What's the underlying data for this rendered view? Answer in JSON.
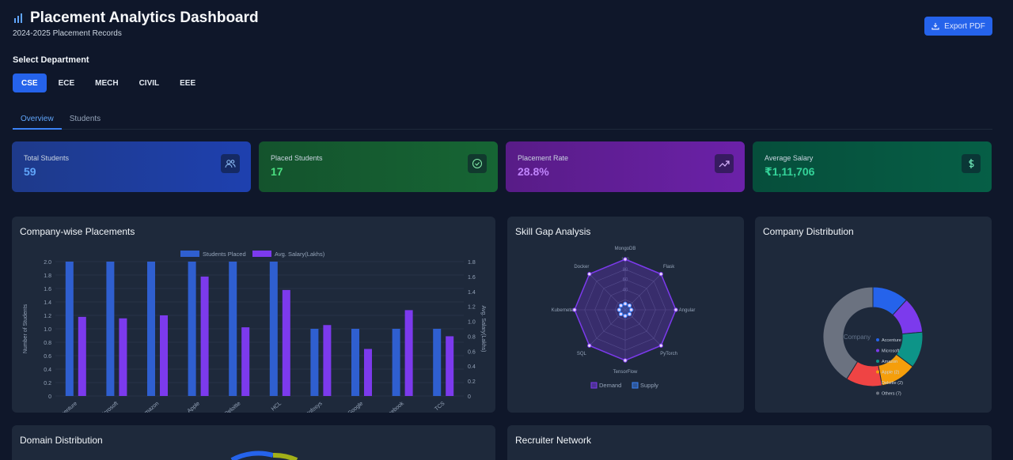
{
  "header": {
    "title": "Placement Analytics Dashboard",
    "subtitle": "2024-2025 Placement Records",
    "export_label": "Export PDF"
  },
  "departments": {
    "label": "Select Department",
    "items": [
      "CSE",
      "ECE",
      "MECH",
      "CIVIL",
      "EEE"
    ],
    "active": "CSE"
  },
  "tabs": [
    "Overview",
    "Students"
  ],
  "stats": [
    {
      "label": "Total Students",
      "value": "59",
      "color": "#60a5fa"
    },
    {
      "label": "Placed Students",
      "value": "17",
      "color": "#4ade80"
    },
    {
      "label": "Placement Rate",
      "value": "28.8%",
      "color": "#c084fc"
    },
    {
      "label": "Average Salary",
      "value": "₹1,11,706",
      "color": "#34d399"
    }
  ],
  "cards": {
    "company_wise": "Company-wise Placements",
    "skill_gap": "Skill Gap Analysis",
    "company_dist": "Company Distribution",
    "domain_dist": "Domain Distribution",
    "recruiter": "Recruiter Network"
  },
  "chart_data": [
    {
      "type": "bar",
      "categories": [
        "Accenture",
        "Microsoft",
        "Amazon",
        "Apple",
        "Deloitte",
        "HCL",
        "Infosys",
        "Google",
        "Facebook",
        "TCS"
      ],
      "series": [
        {
          "name": "Students Placed",
          "values": [
            2,
            2,
            2,
            2,
            2,
            2,
            1,
            1,
            1,
            1
          ],
          "color": "#2f5fd0"
        },
        {
          "name": "Avg. Salary(Lakhs)",
          "values": [
            1.06,
            1.04,
            1.08,
            1.6,
            0.92,
            1.42,
            0.95,
            0.63,
            1.15,
            0.8
          ],
          "color": "#7c3aed"
        }
      ],
      "ylabel": "Number of Students",
      "y2label": "Avg. Salary(Lakhs)",
      "ylim": [
        0,
        2
      ],
      "y2lim": [
        0,
        1.8
      ],
      "yticks": [
        "0",
        "0.2",
        "0.4",
        "0.6",
        "0.8",
        "1.0",
        "1.2",
        "1.4",
        "1.6",
        "1.8",
        "2.0"
      ],
      "y2ticks": [
        "0",
        "0.2",
        "0.4",
        "0.6",
        "0.8",
        "1.0",
        "1.2",
        "1.4",
        "1.6",
        "1.8"
      ]
    },
    {
      "type": "radar",
      "axes": [
        "MongoDB",
        "Flask",
        "Angular",
        "PyTorch",
        "TensorFlow",
        "SQL",
        "Kubernetes",
        "Docker"
      ],
      "rticks": [
        "40",
        "60",
        "80",
        "100"
      ],
      "rmax": 100,
      "series": [
        {
          "name": "Demand",
          "values": [
            100,
            100,
            100,
            100,
            100,
            100,
            100,
            100
          ],
          "color": "#7c3aed"
        },
        {
          "name": "Supply",
          "values": [
            12,
            12,
            12,
            12,
            12,
            12,
            12,
            12
          ],
          "color": "#3b82f6"
        }
      ]
    },
    {
      "type": "pie",
      "center_label": "Company",
      "labels": [
        "Accenture",
        "Microsoft",
        "Amazon",
        "Apple (2)",
        "Deloitte (2)",
        "Others (7)"
      ],
      "values": [
        2,
        2,
        2,
        2,
        2,
        7
      ],
      "colors": [
        "#2563eb",
        "#7c3aed",
        "#0d9488",
        "#f59e0b",
        "#ef4444",
        "#6b7280"
      ]
    }
  ]
}
